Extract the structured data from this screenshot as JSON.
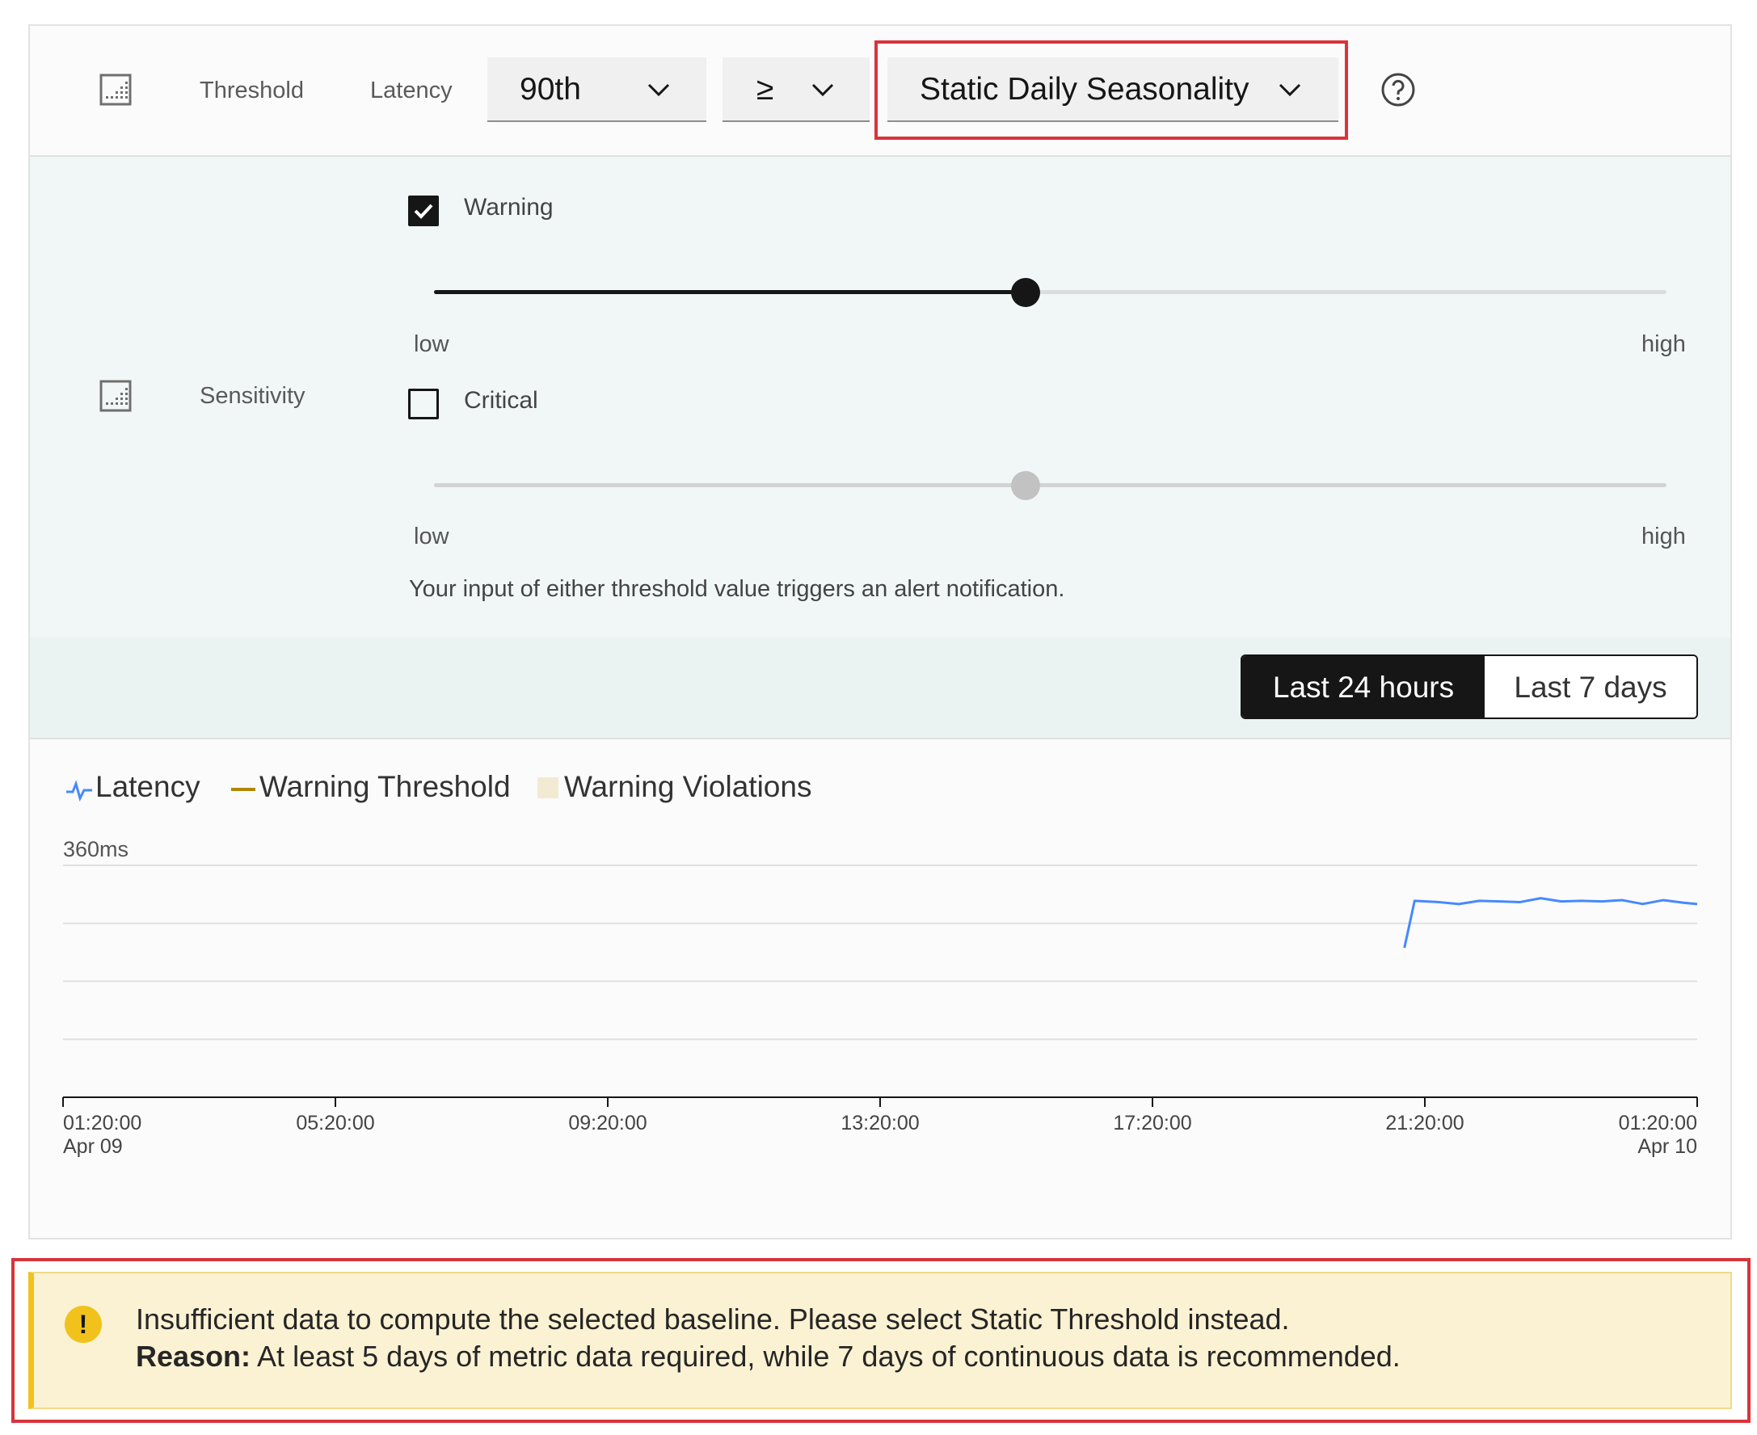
{
  "threshold_row": {
    "type_label": "Threshold",
    "metric_label": "Latency",
    "percentile": {
      "selected": "90th"
    },
    "operator": {
      "selected": "≥"
    },
    "threshold_type": {
      "selected": "Static Daily Seasonality"
    },
    "icon": "chart-grid-icon",
    "help_icon": "help-icon"
  },
  "sensitivity_row": {
    "label": "Sensitivity",
    "icon": "chart-grid-icon",
    "warning": {
      "label": "Warning",
      "checked": true,
      "value_fraction": 0.48,
      "low_label": "low",
      "high_label": "high"
    },
    "critical": {
      "label": "Critical",
      "checked": false,
      "value_fraction": 0.48,
      "low_label": "low",
      "high_label": "high",
      "disabled": true
    },
    "note": "Your input of either threshold value triggers an alert notification."
  },
  "time_range": {
    "options": [
      "Last 24 hours",
      "Last 7 days"
    ],
    "selected": "Last 24 hours"
  },
  "chart_data": {
    "type": "line",
    "legend": [
      {
        "name": "Latency",
        "color": "#4589ff",
        "symbol": "pulse-line"
      },
      {
        "name": "Warning Threshold",
        "color": "#b28600",
        "symbol": "line"
      },
      {
        "name": "Warning Violations",
        "color": "#f3ead3",
        "symbol": "square"
      }
    ],
    "y_top_label": "360ms",
    "ylim": [
      0,
      360
    ],
    "x_ticks": [
      {
        "time": "01:20:00",
        "date": "Apr 09"
      },
      {
        "time": "05:20:00",
        "date": ""
      },
      {
        "time": "09:20:00",
        "date": ""
      },
      {
        "time": "13:20:00",
        "date": ""
      },
      {
        "time": "17:20:00",
        "date": ""
      },
      {
        "time": "21:20:00",
        "date": ""
      },
      {
        "time": "01:20:00",
        "date": "Apr 10"
      }
    ],
    "x_range_hours": [
      0,
      24
    ],
    "series": [
      {
        "name": "Latency",
        "color": "#4589ff",
        "x_hours": [
          19.7,
          19.85,
          20.2,
          20.5,
          20.8,
          21.1,
          21.4,
          21.7,
          22.0,
          22.3,
          22.6,
          22.9,
          23.2,
          23.5,
          23.8,
          24.0
        ],
        "y_ms": [
          232,
          305,
          303,
          300,
          305,
          304,
          303,
          309,
          304,
          305,
          304,
          306,
          300,
          306,
          302,
          300
        ]
      }
    ],
    "grid": true
  },
  "warning_message": {
    "line1": "Insufficient data to compute the selected baseline. Please select Static Threshold instead.",
    "reason_label": "Reason:",
    "reason_text": " At least 5 days of metric data required, while 7 days of continuous data is recommended.",
    "icon": "warning-icon"
  }
}
